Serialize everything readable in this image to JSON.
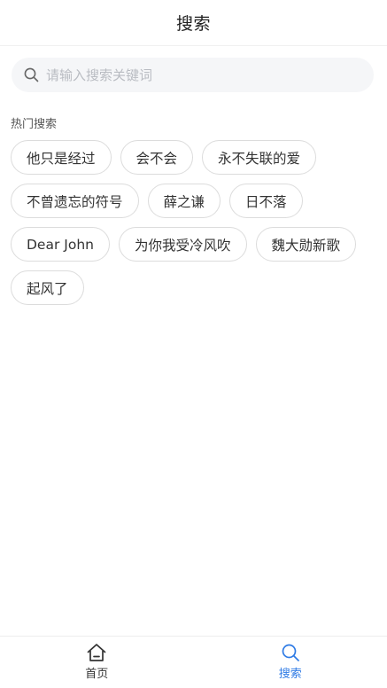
{
  "header": {
    "title": "搜索"
  },
  "search": {
    "placeholder": "请输入搜索关键词",
    "icon": "search-icon"
  },
  "hot": {
    "title": "热门搜索",
    "tags": [
      "他只是经过",
      "会不会",
      "永不失联的爱",
      "不曾遗忘的符号",
      "薛之谦",
      "日不落",
      "Dear John",
      "为你我受冷风吹",
      "魏大勋新歌",
      "起风了"
    ]
  },
  "tabbar": {
    "items": [
      {
        "label": "首页",
        "icon": "home-icon",
        "active": false
      },
      {
        "label": "搜索",
        "icon": "search-icon",
        "active": true
      }
    ],
    "active_color": "#2f7be5",
    "inactive_color": "#333333"
  }
}
